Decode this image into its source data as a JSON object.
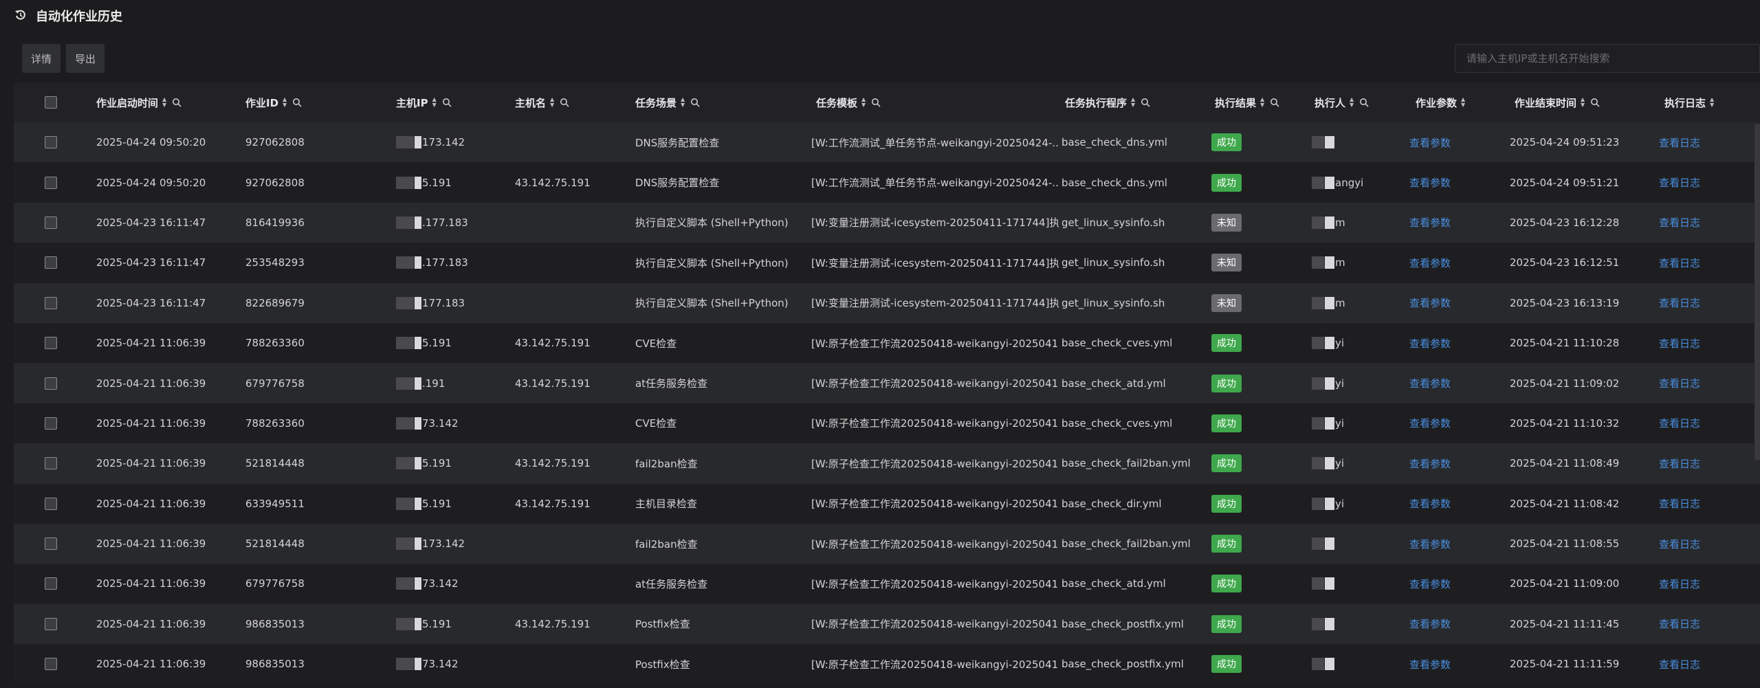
{
  "page": {
    "title": "自动化作业历史"
  },
  "toolbar": {
    "detail_label": "详情",
    "export_label": "导出"
  },
  "search": {
    "placeholder": "请输入主机IP或主机名开始搜索",
    "value": ""
  },
  "columns": {
    "start_time": "作业启动时间",
    "job_id": "作业ID",
    "host_ip": "主机IP",
    "hostname": "主机名",
    "scenario": "任务场景",
    "template": "任务模板",
    "program": "任务执行程序",
    "result": "执行结果",
    "executor": "执行人",
    "params": "作业参数",
    "end_time": "作业结束时间",
    "log": "执行日志"
  },
  "colors": {
    "success": "#3fa84c",
    "unknown": "#6b6b6f",
    "link": "#4a90e2"
  },
  "rows": [
    {
      "start_time": "2025-04-24 09:50:20",
      "job_id": "927062808",
      "ip": "173.142",
      "hostname": "",
      "scenario": "DNS服务配置检查",
      "template": "[W:工作流测试_单任务节点-weikangyi-20250424-...",
      "program": "base_check_dns.yml",
      "result": "成功",
      "executor": "",
      "params": "查看参数",
      "end_time": "2025-04-24 09:51:23",
      "log": "查看日志"
    },
    {
      "start_time": "2025-04-24 09:50:20",
      "job_id": "927062808",
      "ip": "5.191",
      "hostname": "43.142.75.191",
      "scenario": "DNS服务配置检查",
      "template": "[W:工作流测试_单任务节点-weikangyi-20250424-...",
      "program": "base_check_dns.yml",
      "result": "成功",
      "executor": "angyi",
      "params": "查看参数",
      "end_time": "2025-04-24 09:51:21",
      "log": "查看日志"
    },
    {
      "start_time": "2025-04-23 16:11:47",
      "job_id": "816419936",
      "ip": ".177.183",
      "hostname": "",
      "scenario": "执行自定义脚本 (Shell+Python)",
      "template": "[W:变量注册测试-icesystem-20250411-171744]执...",
      "program": "get_linux_sysinfo.sh",
      "result": "未知",
      "executor": "m",
      "params": "查看参数",
      "end_time": "2025-04-23 16:12:28",
      "log": "查看日志"
    },
    {
      "start_time": "2025-04-23 16:11:47",
      "job_id": "253548293",
      "ip": ".177.183",
      "hostname": "",
      "scenario": "执行自定义脚本 (Shell+Python)",
      "template": "[W:变量注册测试-icesystem-20250411-171744]执...",
      "program": "get_linux_sysinfo.sh",
      "result": "未知",
      "executor": "m",
      "params": "查看参数",
      "end_time": "2025-04-23 16:12:51",
      "log": "查看日志"
    },
    {
      "start_time": "2025-04-23 16:11:47",
      "job_id": "822689679",
      "ip": "177.183",
      "hostname": "",
      "scenario": "执行自定义脚本 (Shell+Python)",
      "template": "[W:变量注册测试-icesystem-20250411-171744]执...",
      "program": "get_linux_sysinfo.sh",
      "result": "未知",
      "executor": "m",
      "params": "查看参数",
      "end_time": "2025-04-23 16:13:19",
      "log": "查看日志"
    },
    {
      "start_time": "2025-04-21 11:06:39",
      "job_id": "788263360",
      "ip": "5.191",
      "hostname": "43.142.75.191",
      "scenario": "CVE检查",
      "template": "[W:原子检查工作流20250418-weikangyi-2025041...",
      "program": "base_check_cves.yml",
      "result": "成功",
      "executor": "yi",
      "params": "查看参数",
      "end_time": "2025-04-21 11:10:28",
      "log": "查看日志"
    },
    {
      "start_time": "2025-04-21 11:06:39",
      "job_id": "679776758",
      "ip": ".191",
      "hostname": "43.142.75.191",
      "scenario": "at任务服务检查",
      "template": "[W:原子检查工作流20250418-weikangyi-2025041...",
      "program": "base_check_atd.yml",
      "result": "成功",
      "executor": "yi",
      "params": "查看参数",
      "end_time": "2025-04-21 11:09:02",
      "log": "查看日志"
    },
    {
      "start_time": "2025-04-21 11:06:39",
      "job_id": "788263360",
      "ip": "73.142",
      "hostname": "",
      "scenario": "CVE检查",
      "template": "[W:原子检查工作流20250418-weikangyi-2025041...",
      "program": "base_check_cves.yml",
      "result": "成功",
      "executor": "yi",
      "params": "查看参数",
      "end_time": "2025-04-21 11:10:32",
      "log": "查看日志"
    },
    {
      "start_time": "2025-04-21 11:06:39",
      "job_id": "521814448",
      "ip": "5.191",
      "hostname": "43.142.75.191",
      "scenario": "fail2ban检查",
      "template": "[W:原子检查工作流20250418-weikangyi-2025041...",
      "program": "base_check_fail2ban.yml",
      "result": "成功",
      "executor": "yi",
      "params": "查看参数",
      "end_time": "2025-04-21 11:08:49",
      "log": "查看日志"
    },
    {
      "start_time": "2025-04-21 11:06:39",
      "job_id": "633949511",
      "ip": "5.191",
      "hostname": "43.142.75.191",
      "scenario": "主机目录检查",
      "template": "[W:原子检查工作流20250418-weikangyi-2025041...",
      "program": "base_check_dir.yml",
      "result": "成功",
      "executor": "yi",
      "params": "查看参数",
      "end_time": "2025-04-21 11:08:42",
      "log": "查看日志"
    },
    {
      "start_time": "2025-04-21 11:06:39",
      "job_id": "521814448",
      "ip": "173.142",
      "hostname": "",
      "scenario": "fail2ban检查",
      "template": "[W:原子检查工作流20250418-weikangyi-2025041...",
      "program": "base_check_fail2ban.yml",
      "result": "成功",
      "executor": "",
      "params": "查看参数",
      "end_time": "2025-04-21 11:08:55",
      "log": "查看日志"
    },
    {
      "start_time": "2025-04-21 11:06:39",
      "job_id": "679776758",
      "ip": "73.142",
      "hostname": "",
      "scenario": "at任务服务检查",
      "template": "[W:原子检查工作流20250418-weikangyi-2025041...",
      "program": "base_check_atd.yml",
      "result": "成功",
      "executor": "",
      "params": "查看参数",
      "end_time": "2025-04-21 11:09:00",
      "log": "查看日志"
    },
    {
      "start_time": "2025-04-21 11:06:39",
      "job_id": "986835013",
      "ip": "5.191",
      "hostname": "43.142.75.191",
      "scenario": "Postfix检查",
      "template": "[W:原子检查工作流20250418-weikangyi-2025041...",
      "program": "base_check_postfix.yml",
      "result": "成功",
      "executor": "",
      "params": "查看参数",
      "end_time": "2025-04-21 11:11:45",
      "log": "查看日志"
    },
    {
      "start_time": "2025-04-21 11:06:39",
      "job_id": "986835013",
      "ip": "73.142",
      "hostname": "",
      "scenario": "Postfix检查",
      "template": "[W:原子检查工作流20250418-weikangyi-2025041...",
      "program": "base_check_postfix.yml",
      "result": "成功",
      "executor": "",
      "params": "查看参数",
      "end_time": "2025-04-21 11:11:59",
      "log": "查看日志"
    }
  ]
}
